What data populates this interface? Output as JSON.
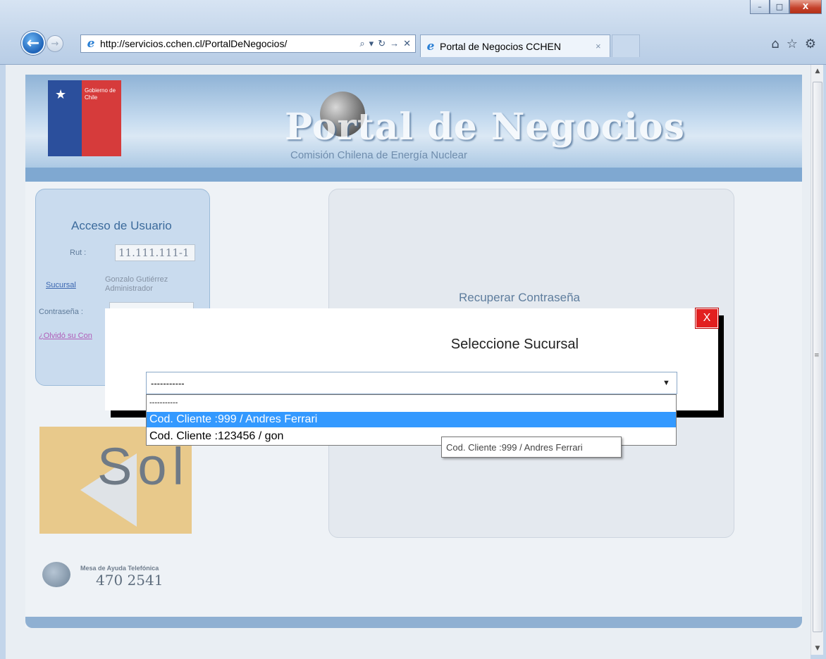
{
  "browser": {
    "address_url": "http://servicios.cchen.cl/PortalDeNegocios/",
    "address_tools": [
      "⌕",
      "▾",
      "↻",
      "→",
      "✕"
    ],
    "tab_title": "Portal de Negocios CCHEN",
    "tab_close": "×",
    "window_buttons": {
      "minimize": "–",
      "maximize": "□",
      "close": "X"
    },
    "right_icons": [
      "home-icon",
      "favorites-star-icon",
      "settings-gear-icon"
    ]
  },
  "banner": {
    "logo_text": "Gobierno de Chile",
    "title": "Portal de Negocios",
    "subtitle": "Comisión Chilena de Energía Nuclear"
  },
  "login": {
    "title": "Acceso de Usuario",
    "rut_label": "Rut :",
    "rut_value": "11.111.111-1",
    "sucursal_label": "Sucursal",
    "sucursal_value": "Gonzalo Gutiérrez Administrador",
    "password_label": "Contraseña :",
    "forgot_link": "¿Olvidó su Con"
  },
  "recover": {
    "title": "Recuperar Contraseña"
  },
  "sol": {
    "text": "Sol"
  },
  "help": {
    "label": "Mesa de Ayuda Telefónica",
    "phone": "470 2541"
  },
  "modal": {
    "title": "Seleccione Sucursal",
    "close_label": "X",
    "select_value": "-----------",
    "options": [
      "-----------",
      "Cod. Cliente :999 / Andres Ferrari",
      "Cod. Cliente :123456 / gon"
    ],
    "selected_index": 1,
    "tooltip": "Cod. Cliente :999 / Andres Ferrari"
  },
  "colors": {
    "selection_highlight": "#3399ff",
    "close_button": "#e21f1f",
    "banner_blue": "#7fa8d1"
  }
}
